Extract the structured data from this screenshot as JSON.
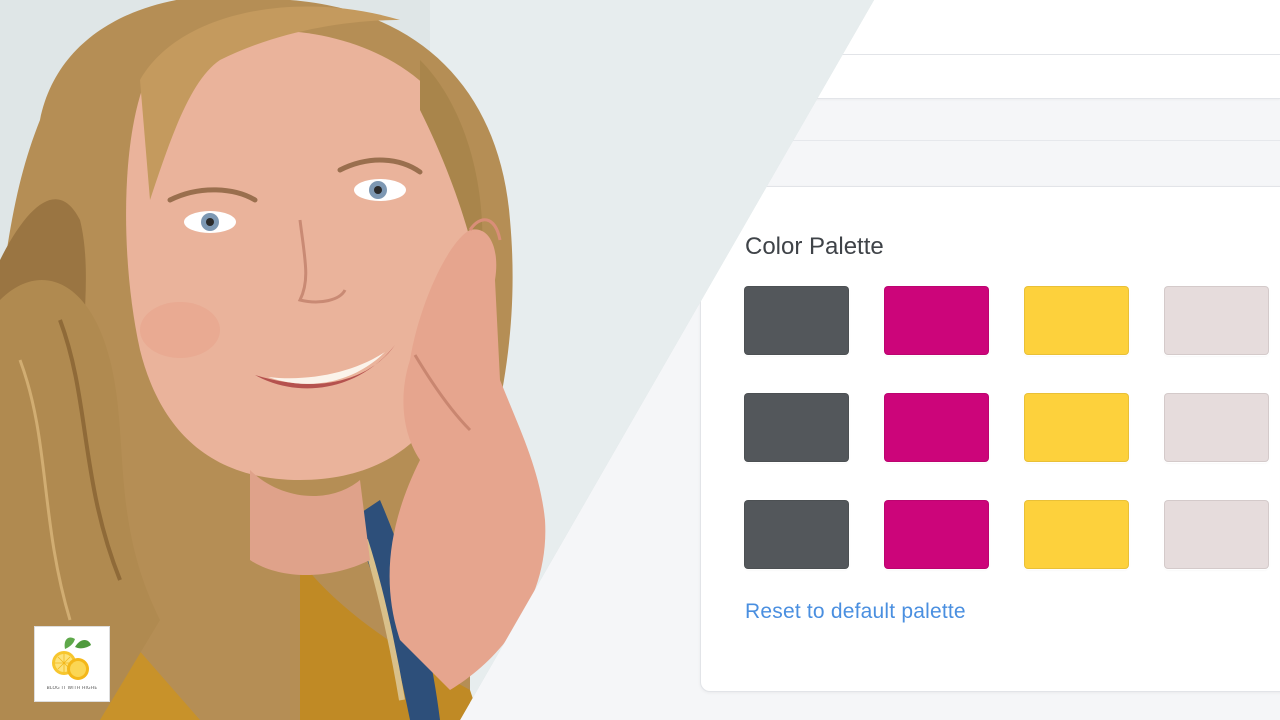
{
  "palette": {
    "title": "Color Palette",
    "reset_label": "Reset to default palette",
    "rows": [
      [
        "#53575b",
        "#cc057a",
        "#fdd13c",
        "#e6dcdc"
      ],
      [
        "#53575b",
        "#cc057a",
        "#fdd13c",
        "#e6dcdc"
      ],
      [
        "#53575b",
        "#cc057a",
        "#fdd13c",
        "#e6dcdc"
      ]
    ],
    "link_color": "#4a8fe0"
  },
  "logo": {
    "text": "BLOG IT WITH HIGHE"
  },
  "icons": {
    "brand_logo": "lemon-logo-icon"
  }
}
